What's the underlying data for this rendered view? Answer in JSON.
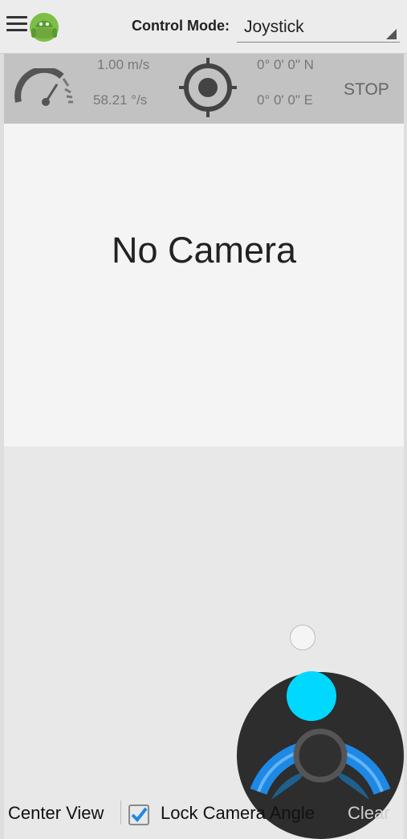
{
  "header": {
    "control_mode_label": "Control Mode:",
    "control_mode_value": "Joystick"
  },
  "status": {
    "speed": "1.00 m/s",
    "rotation": "58.21 °/s",
    "latitude": "0° 0' 0\" N",
    "longitude": "0° 0' 0\" E",
    "stop_label": "STOP"
  },
  "camera": {
    "message": "No Camera"
  },
  "controls": {
    "center_view_label": "Center View",
    "lock_camera_label": "Lock Camera Angle",
    "lock_camera_checked": true,
    "clear_label": "Clear"
  },
  "icons": {
    "menu": "menu-icon",
    "logo": "android-robot-icon",
    "gauge": "speedometer-icon",
    "target": "crosshair-target-icon",
    "checkbox": "checkbox-checked-icon",
    "joystick": "joystick-icon"
  },
  "colors": {
    "accent": "#1e88e5",
    "joystick_knob": "#00d8ff",
    "logo_green": "#6fa83d"
  }
}
